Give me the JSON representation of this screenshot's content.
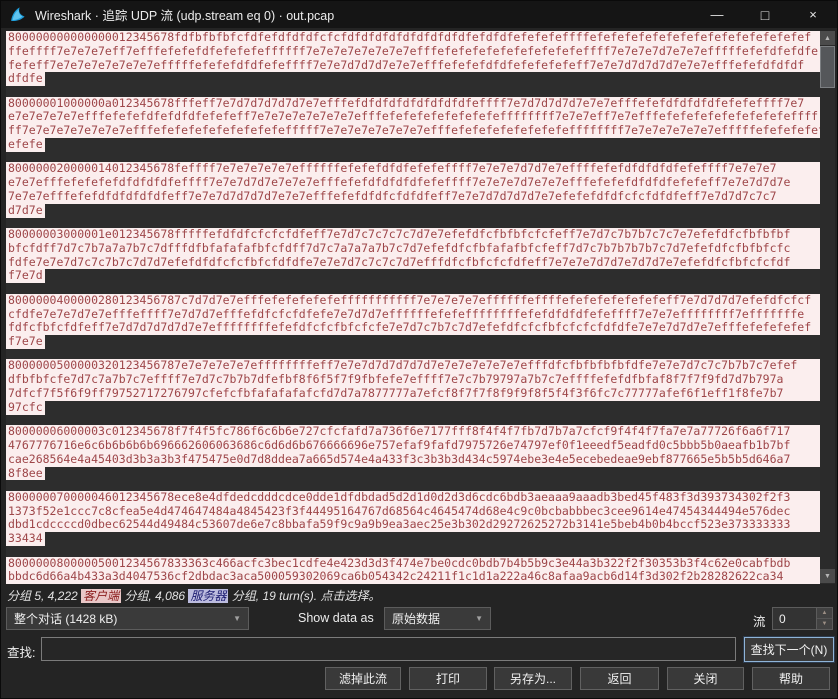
{
  "titlebar": {
    "title": "Wireshark · 追踪 UDP 流 (udp.stream eq 0) · out.pcap",
    "minimize_icon": "—",
    "maximize_icon": "□",
    "close_icon": "×"
  },
  "stream": {
    "chunks": [
      {
        "lines": [
          "800000000000000012345678fdfbfbfbfcfdfefdfdfdfcfcfdfdfdfdfdfdfdfdfdfefdfdfefefefeffffefefefefefefefefefefefefefefefef",
          "ffeffff7e7e7e7eff7efffefefefdfefefefeffffff7e7e7e7e7e7e7e7efffefefefefefefefefefefeffff7e7e7e7d7e7e7efffffefefdfefdfe",
          "fefeff7e7e7e7e7e7e7e7efffffefefefdfdfefeffff7e7e7d7d7d7e7e7efffefefefdfdfefefefefeff7e7e7d7d7d7d7e7e7efffefefdfdfdf",
          "dfdfe"
        ]
      },
      {
        "lines": [
          "80000001000000a012345678fffeff7e7d7d7d7d7d7e7efffefdfdfdfdfdfdfdfdfeffff7e7d7d7d7d7e7e7efffefefdfdfdfdfefefeffff7e7",
          "e7e7e7e7e7efffefefefdfefdfdfefefeff7e7e7e7e7e7e7e7efffefefefefefefefefeffffffff7e7e7eff7e7efffefefefefefefefefefeffff",
          "ff7e7e7e7e7e7e7e7efffefefefefefefefefefefffff7e7e7e7e7e7e7e7efffefefefefefefefefeffffffff7e7e7e7e7e7e7efffffefefefefef",
          "efefe"
        ]
      },
      {
        "lines": [
          "800000020000014012345678feffff7e7e7e7e7e7effffffefefefdfdfefefeffff7e7e7e7d7d7e7effffefefdfdfdfdfefeffff7e7e7e7",
          "e7e7efffefefefefdfdfdfdfeffff7e7e7d7d7e7e7e7efffefefdfdfdfdfefeffff7e7e7e7d7e7e7efffefefefdfdfdfefefeff7e7e7d7d7e",
          "7e7e7efffefefdfdfdfdfdfeff7e7e7d7d7d7d7e7e7efffefefdfdfcfdfdfeff7e7e7d7d7d7d7e7efefefdfdfcfcfdfdfeff7e7d7d7c7c7",
          "d7d7e"
        ]
      },
      {
        "lines": [
          "80000003000001e012345678fffffefdfdfcfcfcfdfeff7e7d7c7c7c7c7d7e7efefdfcfbfbfcfcfeff7e7d7c7b7b7c7c7e7efefdfcfbfbfbf",
          "bfcfdff7d7c7b7a7a7b7c7dfffdfbfafafafbfcfdff7d7c7a7a7a7b7c7d7efefdfcfbfafafbfcfeff7d7c7b7b7b7b7c7d7efefdfcfbfbfcfc",
          "fdfe7e7e7d7c7c7b7c7d7d7efefdfdfcfcfbfcfdfdfe7e7e7d7c7c7c7d7efffdfcfbfcfcfdfeff7e7e7e7d7d7e7d7d7e7efefdfcfbfcfcfdf",
          "f7e7d"
        ]
      },
      {
        "lines": [
          "8000000400000280123456787c7d7d7e7efffefefefefefefffffffffff7e7e7e7e7effffffeffffefefefefefefefeff7e7d7d7d7efefdfcfcf",
          "cfdfe7e7e7d7e7efffeffff7e7d7d7efffefdfcfcfdfefe7e7d7d7effffffefefeffffffffefefdfdfdfefeffff7e7e7effffffff7efffffffe",
          "fdfcfbfcfdfeff7e7d7d7d7d7d7e7effffffffefefdfcfcfbfcfcfe7e7d7c7b7c7d7efefdfcfcfbfcfcfcfdfdfe7e7e7d7d7e7efffefefefefef",
          "f7e7e"
        ]
      },
      {
        "lines": [
          "8000000500000320123456787e7e7e7e7e7effffffffeff7e7e7d7d7d7d7d7e7e7e7e7e7e7efffdfcfbfbfbfbfdfe7e7e7d7c7c7b7b7c7efef",
          "dfbfbfcfe7d7c7a7b7c7effff7e7d7c7b7b7dfefbf8f6f5f7f9fbfefe7effff7e7c7b79797a7b7c7effffefefdfbfaf8f7f7f9fd7d7b797a",
          "7dfcf7f5f6f9ff79752717276797cfefcfbfafafafafcfd7d7a7877777a7efcf8f7f7f8f9f9f8f5f4f3f6fc7c77777afef6f1eff1f8fe7b7",
          "97cfc"
        ]
      },
      {
        "lines": [
          "80000006000003c012345678f7f4f5fc786f6c6b6e727cfcfafd7a736f6e7177fff8f4f4f7fb7d7b7a7cfcf9f4f4f7fa7e7a77726f6a6f717",
          "4767776716e6c6b6b6b6b696662606063686c6d6d6b676666696e757efaf9fafd7975726e74797ef0f1eeedf5eadfd0c5bbb5b0aeafb1b7bf",
          "cae268564e4a45403d3b3a3b3f475475e0d7d8ddea7a665d574e4a433f3c3b3b3d434c5974ebe3e4e5ecebedeae9ebf877665e5b5b5d646a7",
          "8f8ee"
        ]
      },
      {
        "lines": [
          "800000070000046012345678ece8e4dfdedcdddcdce0dde1dfdbdad5d2d1d0d2d3d6cdc6bdb3aeaaa9aaadb3bed45f483f3d393734302f2f3",
          "1373f52e1ccc7c8cfea5e4d474647484a4845423f3f44495164767d68564c4645474d68e4c9c0bcbabbbec3cee9614e47454344494e576dec",
          "dbd1cdccccd0dbec62544d49484c53607de6e7c8bbafa59f9c9a9b9ea3aec25e3b302d29272625272b3141e5beb4b0b4bccf523e373333333",
          "33434"
        ]
      },
      {
        "lines": [
          "80000008000005001234567833363c466acfc3bec1cdfe4e423d3d3f474e7be0cdc0bdb7b4b5b9c3e44a3b322f2f30353b3f4c62e0cabfbdb",
          "bbdc6d66a4b433a3d4047536cf2dbdac3aca500059302069ca6b054342c24211f1c1d1a222a46c8afaa9acb6d14f3d302f2b28282622ca34"
        ]
      }
    ]
  },
  "status": {
    "prefix": "分组 5, 4,222 ",
    "client_badge": "客户端",
    "between": " 分组, 4,086 ",
    "server_badge": "服务器",
    "suffix": " 分组, 19 turn(s). 点击选择。"
  },
  "controls": {
    "conversation_dropdown": "整个对话  (1428 kB)",
    "show_data_as_label": "Show data as",
    "format_dropdown": "原始数据",
    "stream_label": "流",
    "stream_value": "0",
    "dropdown_icon": "▼",
    "spin_up_icon": "▲",
    "spin_down_icon": "▼"
  },
  "find": {
    "label": "查找:",
    "value": "",
    "find_next_button": "查找下一个(N)"
  },
  "actions": {
    "filter_out": "滤掉此流",
    "print": "打印",
    "save_as": "另存为...",
    "back": "返回",
    "close": "关闭",
    "help": "帮助"
  },
  "scrollbar": {
    "up_icon": "▲",
    "down_icon": "▼"
  },
  "colors": {
    "client_text": "#9e4649",
    "client_bg": "#fbeeee",
    "window_bg": "#242424",
    "focus_border": "#8fb4d8",
    "wireshark_blue": "#1d9bd8"
  }
}
